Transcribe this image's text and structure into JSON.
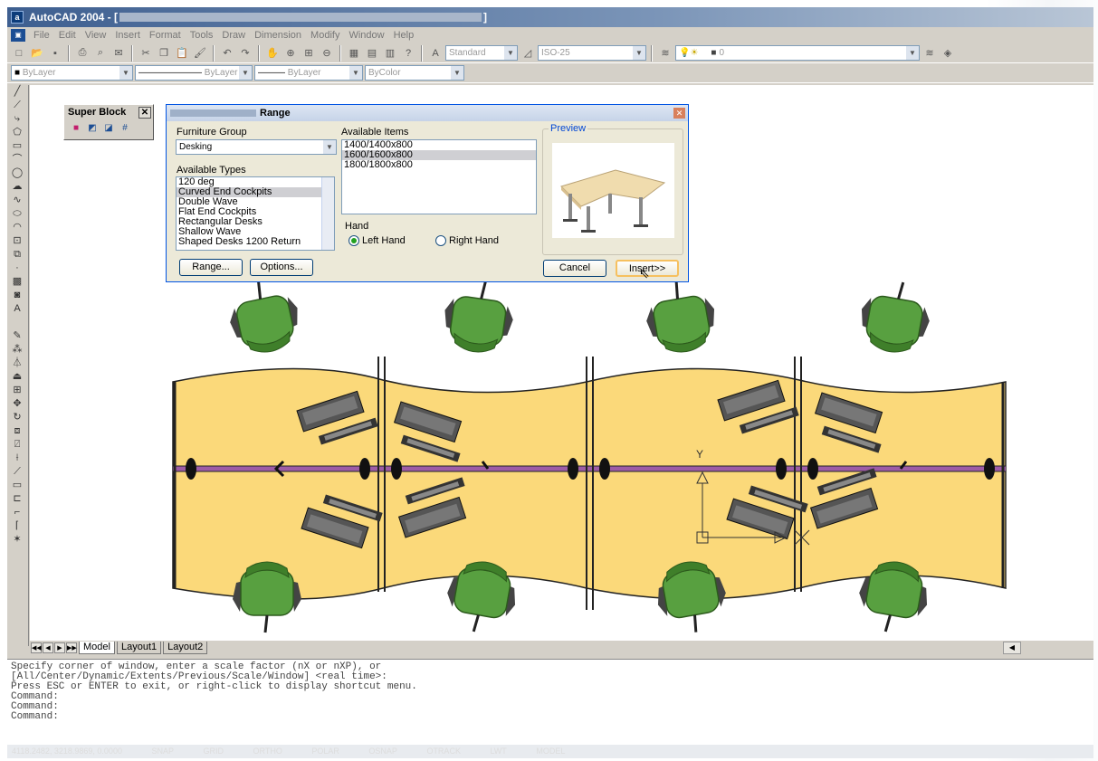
{
  "window": {
    "app_title": "AutoCAD 2004 - [",
    "title_suffix": "]"
  },
  "menu": [
    "File",
    "Edit",
    "View",
    "Insert",
    "Format",
    "Tools",
    "Draw",
    "Dimension",
    "Modify",
    "Window",
    "Help"
  ],
  "toolbar": {
    "text_style": "Standard",
    "dim_style": "ISO-25",
    "layer_value": "0"
  },
  "properties": {
    "color": "ByLayer",
    "linetype": "ByLayer",
    "lineweight": "ByLayer",
    "plotstyle": "ByColor"
  },
  "left_tools": [
    "line-icon",
    "xline-icon",
    "pline-icon",
    "polygon-icon",
    "rectangle-icon",
    "arc-icon",
    "circle-icon",
    "cloud-icon",
    "spline-icon",
    "ellipse-icon",
    "ellipse-arc-icon",
    "insert-block-icon",
    "make-block-icon",
    "point-icon",
    "hatch-icon",
    "region-icon",
    "mtext-icon"
  ],
  "super_block": {
    "title": "Super Block",
    "close": "✕"
  },
  "dialog": {
    "title": "Range",
    "furniture_group_label": "Furniture Group",
    "furniture_group_value": "Desking",
    "available_types_label": "Available Types",
    "available_types": [
      "120 deg",
      "Curved End Cockpits",
      "Double Wave",
      "Flat End Cockpits",
      "Rectangular Desks",
      "Shallow Wave",
      "Shaped Desks 1200 Return"
    ],
    "available_types_selected": 1,
    "available_items_label": "Available Items",
    "available_items": [
      "1400/1400x800",
      "1600/1600x800",
      "1800/1800x800"
    ],
    "available_items_selected": 1,
    "hand_label": "Hand",
    "left_hand": "Left Hand",
    "right_hand": "Right Hand",
    "hand_selected": "left",
    "range_button": "Range...",
    "options_button": "Options...",
    "preview_label": "Preview",
    "cancel_button": "Cancel",
    "insert_button": "Insert>>",
    "close": "✕"
  },
  "tabs": {
    "model": "Model",
    "layout1": "Layout1",
    "layout2": "Layout2"
  },
  "command_lines": [
    "Specify corner of window, enter a scale factor (nX or nXP), or",
    "[All/Center/Dynamic/Extents/Previous/Scale/Window] <real time>:",
    "Press ESC or ENTER to exit, or right-click to display shortcut menu.",
    "Command:",
    "Command:",
    "Command:"
  ],
  "status": {
    "coords": "4118.2482, 3218.9869, 0.0000",
    "toggles": [
      "SNAP",
      "GRID",
      "ORTHO",
      "POLAR",
      "OSNAP",
      "OTRACK",
      "LWT",
      "MODEL"
    ]
  },
  "colors": {
    "desk": "#fbd97a",
    "chair": "#58a040",
    "divider": "#9d5ca6"
  }
}
